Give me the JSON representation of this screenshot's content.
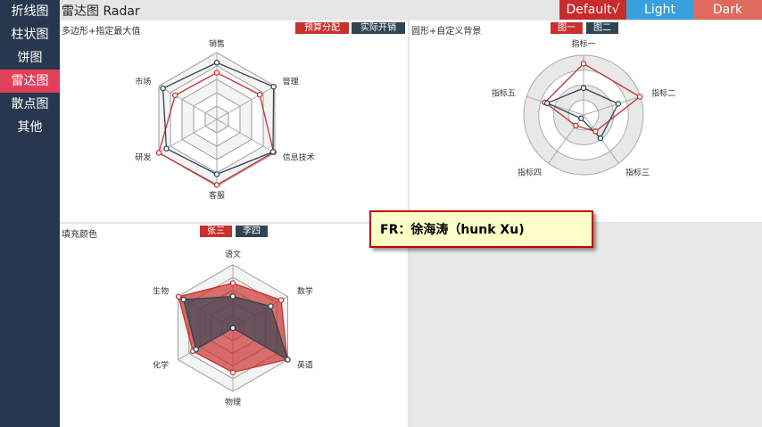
{
  "sidebar": {
    "items": [
      {
        "label": "折线图",
        "active": false
      },
      {
        "label": "柱状图",
        "active": false
      },
      {
        "label": "饼图",
        "active": false
      },
      {
        "label": "雷达图",
        "active": true
      },
      {
        "label": "散点图",
        "active": false
      },
      {
        "label": "其他",
        "active": false
      }
    ]
  },
  "header": {
    "title": "雷达图 Radar",
    "themes": {
      "default": "Default√",
      "light": "Light",
      "dark": "Dark"
    }
  },
  "author_note": "FR：徐海涛（hunk Xu)",
  "colors": {
    "series_a": "#c8312e",
    "series_b": "#2f4554",
    "active_nav": "#e0405a",
    "sidebar_bg": "#27384e"
  },
  "chart_data": [
    {
      "type": "radar",
      "title": "多边形+指定最大值",
      "shape": "polygon",
      "indicators": [
        "销售",
        "管理",
        "信息技术",
        "客服",
        "研发",
        "市场"
      ],
      "max": 1,
      "split_number": 5,
      "series": [
        {
          "name": "预算分配",
          "values": [
            0.7,
            0.74,
            0.98,
            0.98,
            1.0,
            0.72
          ],
          "color": "#c8312e",
          "filled": false
        },
        {
          "name": "实际开销",
          "values": [
            0.85,
            0.98,
            0.97,
            0.82,
            0.87,
            0.93
          ],
          "color": "#2f4554",
          "filled": false
        }
      ]
    },
    {
      "type": "radar",
      "title": "圆形+自定义背景",
      "shape": "circle",
      "indicators": [
        "指标一",
        "指标二",
        "指标三",
        "指标四",
        "指标五"
      ],
      "max": 1,
      "split_number": 4,
      "series": [
        {
          "name": "图一",
          "values": [
            0.86,
            0.99,
            0.34,
            0.22,
            0.68
          ],
          "color": "#c8312e",
          "filled": false
        },
        {
          "name": "图二",
          "values": [
            0.45,
            0.61,
            0.48,
            0.07,
            0.64
          ],
          "color": "#2f4554",
          "filled": false
        }
      ]
    },
    {
      "type": "radar",
      "title": "填充颜色",
      "shape": "polygon",
      "indicators": [
        "语文",
        "数学",
        "英语",
        "物理",
        "化学",
        "生物"
      ],
      "max": 1,
      "split_number": 5,
      "series": [
        {
          "name": "张三",
          "values": [
            0.71,
            0.88,
            0.99,
            0.7,
            0.73,
            0.99
          ],
          "color": "#c8312e",
          "filled": true
        },
        {
          "name": "李四",
          "values": [
            0.5,
            0.69,
            1.0,
            0.0,
            0.67,
            0.9
          ],
          "color": "#2f4554",
          "filled": true
        }
      ]
    }
  ]
}
